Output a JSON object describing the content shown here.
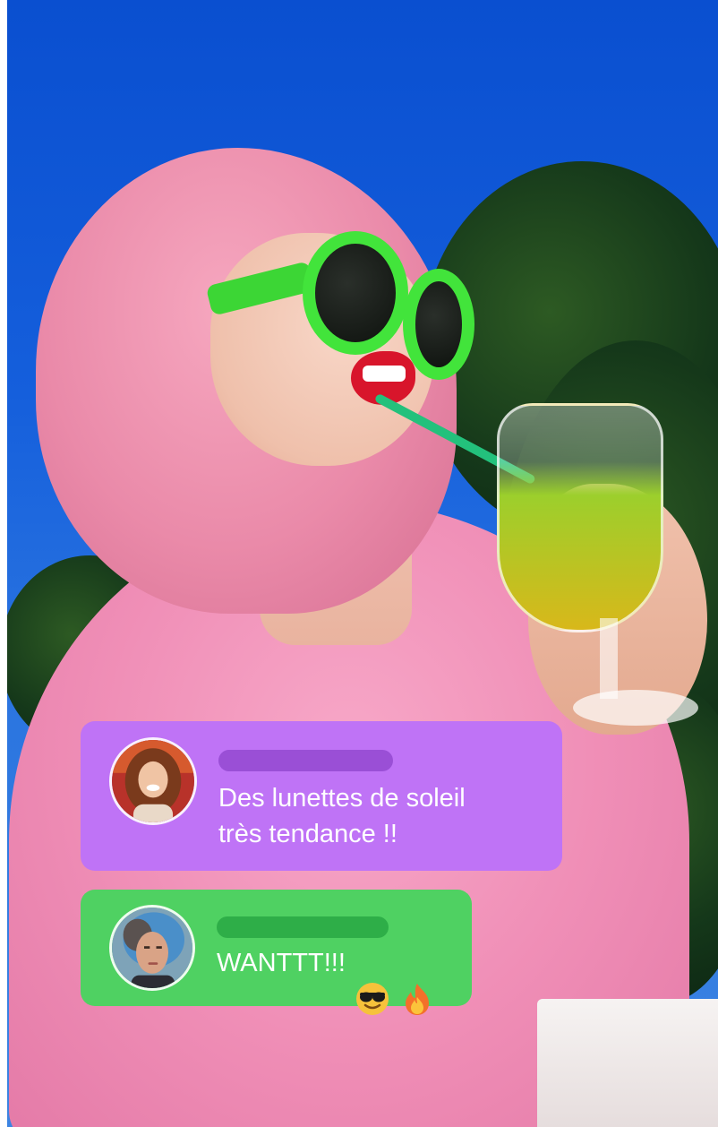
{
  "comments": [
    {
      "message": "Des lunettes de soleil\ntrès tendance !!",
      "color": "#bf73f6",
      "avatar": "avatar-woman-curly-hair"
    },
    {
      "message": "WANTTT!!!",
      "emojis": [
        "sunglasses-emoji-icon",
        "fire-emoji-icon"
      ],
      "color": "#4fd162",
      "avatar": "avatar-woman-blue-hair"
    }
  ]
}
